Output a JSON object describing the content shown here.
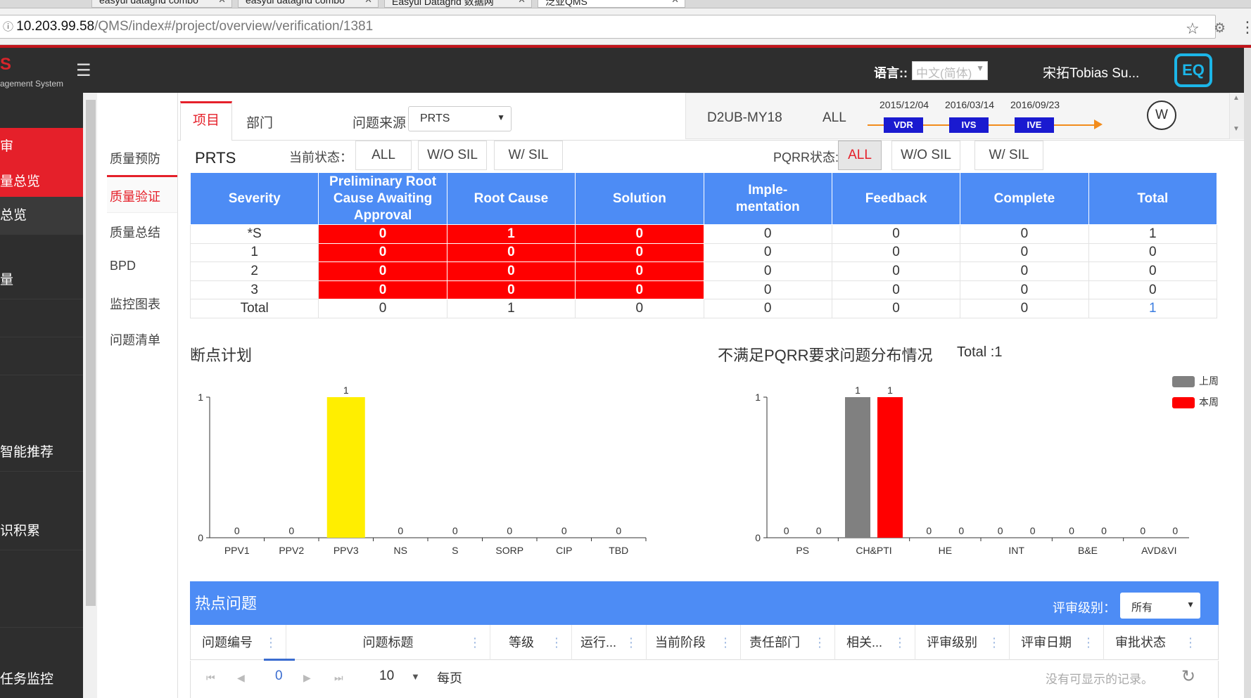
{
  "browser": {
    "tabs": [
      "easyui datagrid combo",
      "easyui datagrid combo",
      "Easyui Datagrid 数据网",
      "泛亚QMS"
    ],
    "url_host": "10.203.99.58",
    "url_path": "/QMS/index#/project/overview/verification/1381"
  },
  "header": {
    "logo_text": "S",
    "logo_sub": "agement System",
    "lang_label": "语言::",
    "lang_value": "中文(简体)",
    "user": "宋拓Tobias Su...",
    "brand": "EQ"
  },
  "sidebar": {
    "items": [
      "审",
      "量总览",
      "总览",
      "量",
      "智能推荐",
      "识积累",
      "任务监控"
    ]
  },
  "subnav": {
    "items": [
      "质量预防",
      "质量验证",
      "质量总结",
      "BPD",
      "监控图表",
      "问题清单"
    ]
  },
  "tabs": {
    "project": "项目",
    "dept": "部门",
    "source_label": "问题来源",
    "source_value": "PRTS"
  },
  "milestones": {
    "project_code": "D2UB-MY18",
    "scope": "ALL",
    "items": [
      {
        "date": "2015/12/04",
        "label": "VDR"
      },
      {
        "date": "2016/03/14",
        "label": "IVS"
      },
      {
        "date": "2016/09/23",
        "label": "IVE"
      }
    ],
    "badge": "W"
  },
  "filters": {
    "title": "PRTS",
    "current_label": "当前状态：",
    "current_opts": [
      "ALL",
      "W/O SIL",
      "W/ SIL"
    ],
    "pqrr_label": "PQRR状态:",
    "pqrr_opts": [
      "ALL",
      "W/O SIL",
      "W/ SIL"
    ],
    "pqrr_selected": "ALL"
  },
  "grid": {
    "headers": [
      "Severity",
      "Preliminary Root Cause Awaiting Approval",
      "Root Cause",
      "Solution",
      "Imple-mentation",
      "Feedback",
      "Complete",
      "Total"
    ],
    "rows": [
      [
        "*S",
        "0",
        "1",
        "0",
        "0",
        "0",
        "0",
        "1"
      ],
      [
        "1",
        "0",
        "0",
        "0",
        "0",
        "0",
        "0",
        "0"
      ],
      [
        "2",
        "0",
        "0",
        "0",
        "0",
        "0",
        "0",
        "0"
      ],
      [
        "3",
        "0",
        "0",
        "0",
        "0",
        "0",
        "0",
        "0"
      ],
      [
        "Total",
        "0",
        "1",
        "0",
        "0",
        "0",
        "0",
        "1"
      ]
    ]
  },
  "hot": {
    "title": "热点问题",
    "level_label": "评审级别：",
    "level_value": "所有",
    "columns": [
      "问题编号",
      "问题标题",
      "等级",
      "运行...",
      "当前阶段",
      "责任部门",
      "相关...",
      "评审级别",
      "评审日期",
      "审批状态"
    ],
    "pager": {
      "page": "0",
      "size": "10",
      "per_label": "每页",
      "empty": "没有可显示的记录。"
    }
  },
  "chart_data": [
    {
      "type": "bar",
      "title": "断点计划",
      "categories": [
        "PPV1",
        "PPV2",
        "PPV3",
        "NS",
        "S",
        "SORP",
        "CIP",
        "TBD"
      ],
      "values": [
        0,
        0,
        1,
        0,
        0,
        0,
        0,
        0
      ],
      "ylim": [
        0,
        1
      ],
      "bar_color": "#ffee00",
      "xlabel": "",
      "ylabel": ""
    },
    {
      "type": "bar",
      "title": "不满足PQRR要求问题分布情况",
      "subtitle": "Total :1",
      "categories": [
        "PS",
        "CH&PTI",
        "HE",
        "INT",
        "B&E",
        "AVD&VI"
      ],
      "series": [
        {
          "name": "上周",
          "color": "#808080",
          "values": [
            0,
            1,
            0,
            0,
            0,
            0
          ]
        },
        {
          "name": "本周",
          "color": "#ff0000",
          "values": [
            0,
            1,
            0,
            0,
            0,
            0
          ]
        }
      ],
      "ylim": [
        0,
        1
      ],
      "legend": "top-right",
      "xlabel": "",
      "ylabel": ""
    }
  ]
}
